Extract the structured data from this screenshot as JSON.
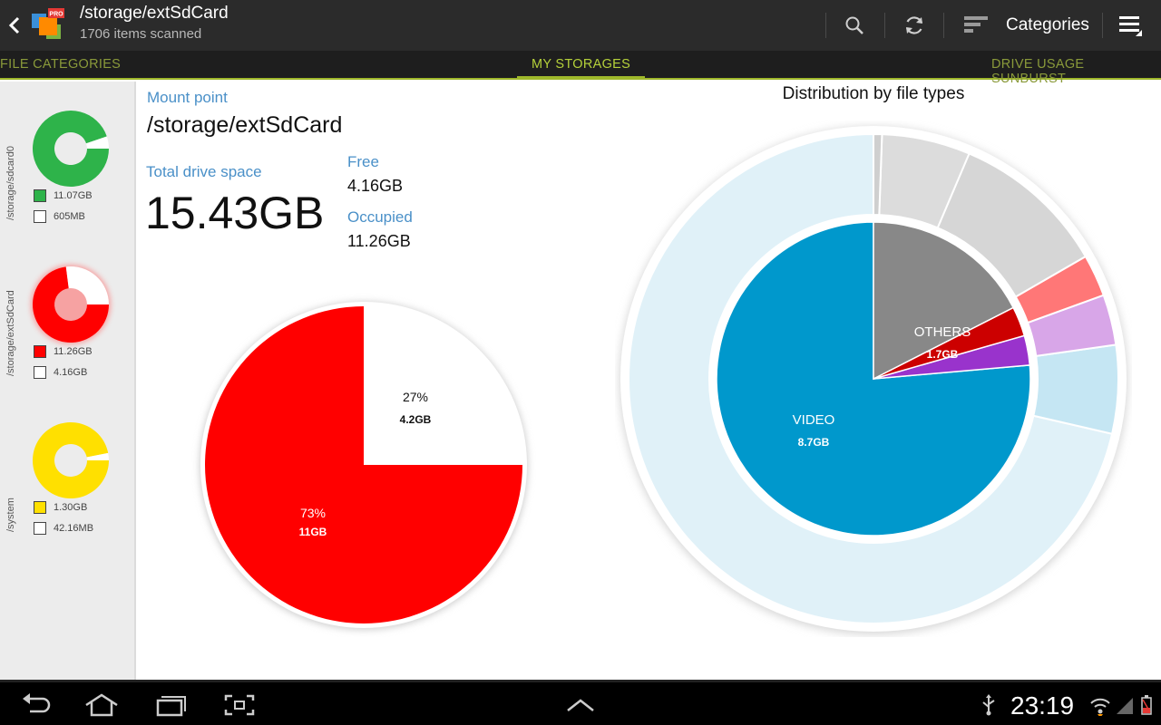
{
  "actionbar": {
    "path": "/storage/extSdCard",
    "subtitle": "1706 items scanned",
    "categories_label": "Categories",
    "logo_badge": "PRO"
  },
  "tabs": [
    {
      "label": "FILE CATEGORIES"
    },
    {
      "label": "MY STORAGES"
    },
    {
      "label": "DRIVE USAGE SUNBURST"
    }
  ],
  "sidebar": {
    "storages": [
      {
        "name": "/storage/sdcard0",
        "used": "11.07GB",
        "free": "605MB",
        "color": "#2eb34a",
        "used_fraction": 0.948
      },
      {
        "name": "/storage/extSdCard",
        "used": "11.26GB",
        "free": "4.16GB",
        "color": "#ff0000",
        "used_fraction": 0.73
      },
      {
        "name": "/system",
        "used": "1.30GB",
        "free": "42.16MB",
        "color": "#ffe000",
        "used_fraction": 0.969
      }
    ]
  },
  "info": {
    "mount_label": "Mount point",
    "mount_value": "/storage/extSdCard",
    "total_label": "Total drive space",
    "total_value": "15.43GB",
    "free_label": "Free",
    "free_value": "4.16GB",
    "occupied_label": "Occupied",
    "occupied_value": "11.26GB"
  },
  "usage_pie": {
    "occupied": {
      "pct": "73%",
      "size": "11GB",
      "fraction": 0.75,
      "color": "#ff0000"
    },
    "free": {
      "pct": "27%",
      "size": "4.2GB",
      "fraction": 0.25,
      "color": "#ffffff"
    }
  },
  "distribution": {
    "title": "Distribution by file types",
    "inner": [
      {
        "label": "VIDEO",
        "size": "8.7GB",
        "start_deg": 90,
        "end_deg": 365,
        "color": "#0098cc"
      },
      {
        "label": "",
        "size": "",
        "start_deg": 5,
        "end_deg": 16,
        "color": "#9933cc"
      },
      {
        "label": "",
        "size": "",
        "start_deg": 16,
        "end_deg": 27,
        "color": "#cc0000"
      },
      {
        "label": "OTHERS",
        "size": "1.7GB",
        "start_deg": 27,
        "end_deg": 90,
        "color": "#888888"
      }
    ],
    "outer": [
      {
        "start_deg": 90,
        "end_deg": 347,
        "color": "#e0f1f8"
      },
      {
        "start_deg": 347,
        "end_deg": 368,
        "color": "#c5e6f3"
      },
      {
        "start_deg": 8,
        "end_deg": 20,
        "color": "#d8a6e8"
      },
      {
        "start_deg": 20,
        "end_deg": 30,
        "color": "#ff7777"
      },
      {
        "start_deg": 30,
        "end_deg": 67,
        "color": "#d6d6d6"
      },
      {
        "start_deg": 67,
        "end_deg": 88,
        "color": "#dcdcdc"
      },
      {
        "start_deg": 88,
        "end_deg": 90,
        "color": "#cfcfcf"
      }
    ]
  },
  "statusbar": {
    "time": "23:19"
  }
}
